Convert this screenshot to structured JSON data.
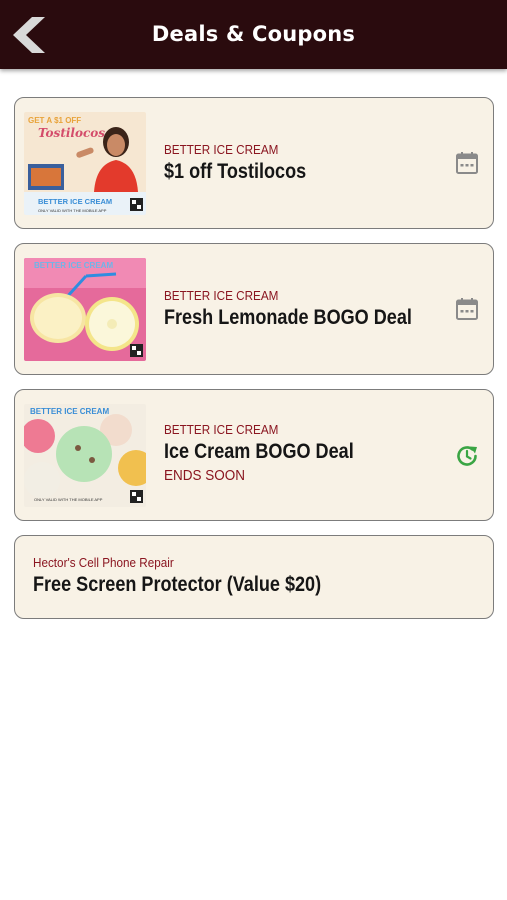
{
  "header": {
    "title": "Deals & Coupons",
    "back_icon": "chevron-left-icon"
  },
  "colors": {
    "header_bg": "#2a0b0e",
    "card_bg": "#f8f2e6",
    "business_text": "#8a1520",
    "ends_soon_icon": "#3aa544",
    "calendar_icon": "#8a8a8a"
  },
  "deals": [
    {
      "business": "BETTER ICE CREAM",
      "title": "$1 off Tostilocos",
      "status": "",
      "icon": "calendar-icon",
      "thumb": {
        "headline": "GET A $1 OFF",
        "script": "Tostilocos",
        "brand": "BETTER ICE CREAM",
        "note": "ONLY VALID WITH THE MOBILE APP"
      }
    },
    {
      "business": "BETTER ICE CREAM",
      "title": "Fresh Lemonade BOGO Deal",
      "status": "",
      "icon": "calendar-icon",
      "thumb": {
        "brand": "BETTER ICE CREAM"
      }
    },
    {
      "business": "BETTER ICE CREAM",
      "title": "Ice Cream BOGO Deal",
      "status": "ENDS SOON",
      "icon": "clock-refresh-icon",
      "thumb": {
        "brand": "BETTER ICE CREAM",
        "note": "ONLY VALID WITH THE MOBILE APP"
      }
    },
    {
      "business": "Hector's Cell Phone Repair",
      "title": "Free Screen Protector (Value $20)",
      "status": "",
      "icon": "",
      "thumb": null
    }
  ]
}
